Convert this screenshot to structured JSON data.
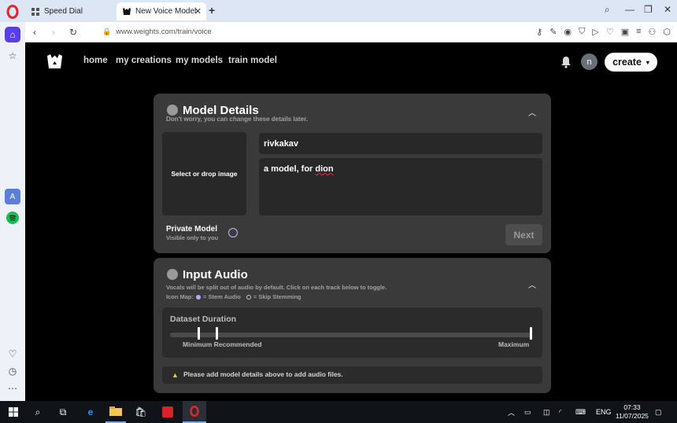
{
  "browser": {
    "tabs": [
      {
        "label": "Speed Dial",
        "active": false
      },
      {
        "label": "New Voice Model",
        "active": true
      }
    ],
    "url": "www.weights.com/train/voice"
  },
  "nav": {
    "links": [
      "home",
      "my creations",
      "my models",
      "train model"
    ],
    "avatar_initial": "n",
    "create_label": "create"
  },
  "model_details": {
    "title": "Model Details",
    "subtitle": "Don't worry, you can change these details later.",
    "image_placeholder": "Select or drop image",
    "name_value": "rivkakav",
    "description_value_a": "a model, for ",
    "description_value_b": "dion",
    "private_title": "Private Model",
    "private_subtitle": "Visible only to you",
    "next_label": "Next"
  },
  "input_audio": {
    "title": "Input Audio",
    "subtitle": "Vocals will be split out of audio by default. Click on each track below to toggle.",
    "icon_map_label": "Icon Map:",
    "stem_label": "= Stem Audio",
    "skip_label": "= Skip Stemming",
    "duration_title": "Dataset Duration",
    "min_label": "Minimum Recommended",
    "max_label": "Maximum",
    "warning": "Please add model details above to add audio files."
  },
  "taskbar": {
    "language": "ENG",
    "time": "07:33",
    "date": "11/07/2025"
  },
  "colors": {
    "accent": "#5a3de8",
    "card": "#3a3a3a",
    "warning": "#f2c230"
  }
}
